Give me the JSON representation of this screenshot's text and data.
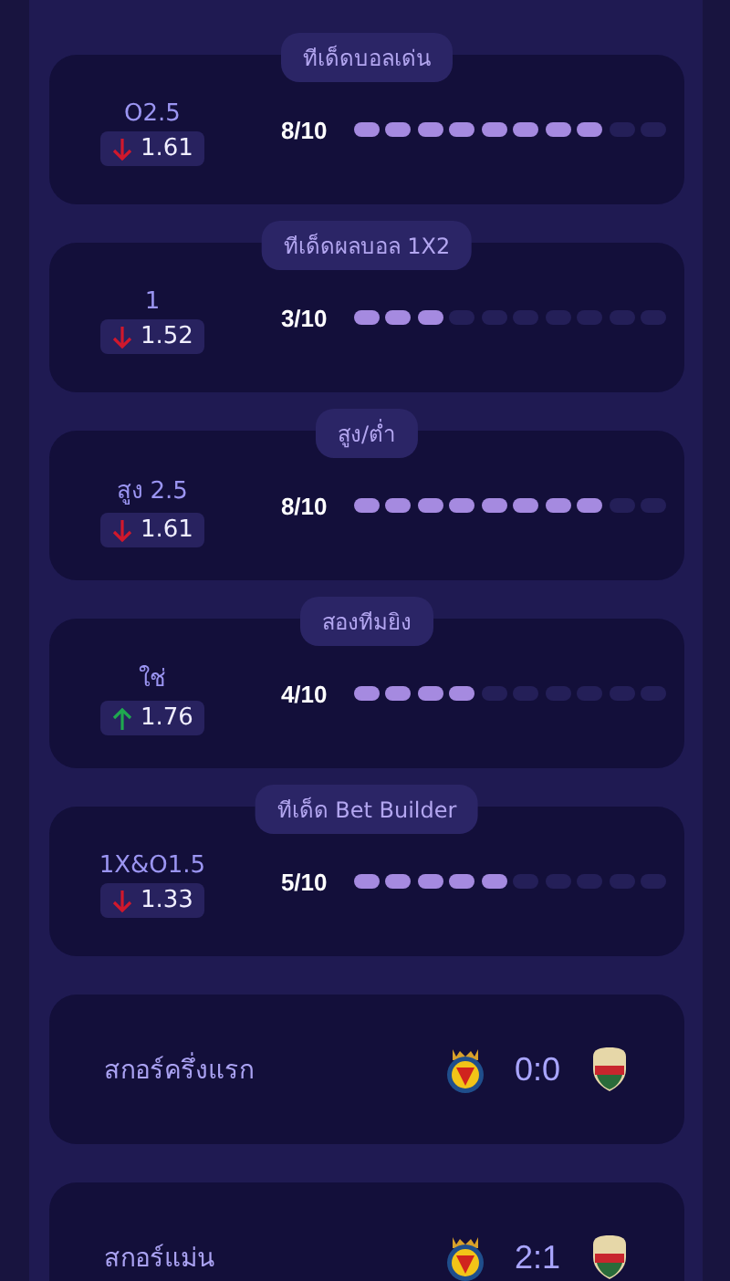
{
  "tips": [
    {
      "title": "ทีเด็ดบอลเด่น",
      "market": "O2.5",
      "rising": false,
      "odds": "1.61",
      "score": "8/10",
      "level": 0.8
    },
    {
      "title": "ทีเด็ดผลบอล 1X2",
      "market": "1",
      "rising": false,
      "odds": "1.52",
      "score": "3/10",
      "level": 0.3
    },
    {
      "title": "สูง/ต่ำ",
      "market": "สูง 2.5",
      "rising": false,
      "odds": "1.61",
      "score": "8/10",
      "level": 0.8
    },
    {
      "title": "สองทีมยิง",
      "market": "ใช่",
      "rising": true,
      "odds": "1.76",
      "score": "4/10",
      "level": 0.4
    },
    {
      "title": "ทีเด็ด Bet Builder",
      "market": "1X&O1.5",
      "rising": false,
      "odds": "1.33",
      "score": "5/10",
      "level": 0.5
    }
  ],
  "scores": [
    {
      "label": "สกอร์ครึ่งแรก",
      "score": "0:0"
    },
    {
      "label": "สกอร์แม่น",
      "score": "2:1"
    }
  ]
}
